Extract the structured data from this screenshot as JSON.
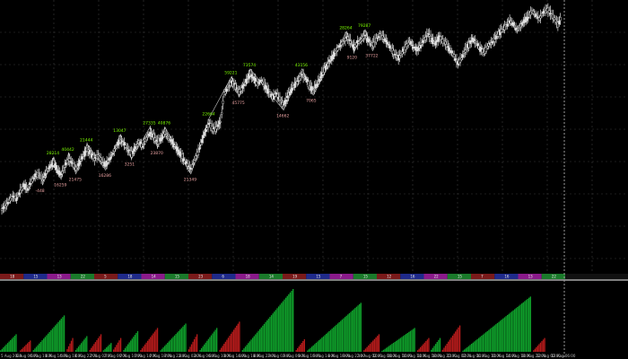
{
  "chart_data": {
    "type": "candlestick-with-histogram",
    "title": "",
    "xlabel": "",
    "ylabel": "",
    "price": [
      0.08,
      0.1,
      0.13,
      0.15,
      0.14,
      0.18,
      0.21,
      0.19,
      0.23,
      0.26,
      0.27,
      0.24,
      0.28,
      0.31,
      0.33,
      0.29,
      0.27,
      0.31,
      0.35,
      0.33,
      0.3,
      0.33,
      0.37,
      0.4,
      0.38,
      0.35,
      0.37,
      0.34,
      0.32,
      0.35,
      0.38,
      0.42,
      0.45,
      0.43,
      0.4,
      0.38,
      0.41,
      0.44,
      0.42,
      0.46,
      0.49,
      0.47,
      0.44,
      0.46,
      0.49,
      0.46,
      0.44,
      0.41,
      0.38,
      0.35,
      0.32,
      0.3,
      0.34,
      0.39,
      0.45,
      0.5,
      0.54,
      0.51,
      0.52,
      0.55,
      0.7,
      0.73,
      0.76,
      0.74,
      0.71,
      0.73,
      0.77,
      0.8,
      0.78,
      0.75,
      0.77,
      0.74,
      0.71,
      0.68,
      0.7,
      0.67,
      0.64,
      0.68,
      0.72,
      0.75,
      0.77,
      0.8,
      0.78,
      0.74,
      0.72,
      0.75,
      0.79,
      0.83,
      0.86,
      0.89,
      0.92,
      0.95,
      0.97,
      1.0,
      0.98,
      0.95,
      0.97,
      0.99,
      1.01,
      0.98,
      0.96,
      0.99,
      1.01,
      1.0,
      0.97,
      0.94,
      0.91,
      0.89,
      0.92,
      0.95,
      0.98,
      0.95,
      0.93,
      0.96,
      0.99,
      1.02,
      0.99,
      0.97,
      1.0,
      0.98,
      0.96,
      0.93,
      0.9,
      0.86,
      0.89,
      0.93,
      0.96,
      0.99,
      0.97,
      0.94,
      0.92,
      0.95,
      0.97,
      0.99,
      1.02,
      1.04,
      1.06,
      1.09,
      1.07,
      1.04,
      1.06,
      1.09,
      1.11,
      1.14,
      1.12,
      1.1,
      1.13,
      1.15,
      1.13,
      1.1,
      1.07,
      1.11
    ],
    "swing_high_labels": [
      "28214",
      "40442",
      "21444",
      "13047",
      "27335",
      "40876",
      "22664",
      "59221",
      "73574",
      "43156",
      "28264",
      "79287"
    ],
    "swing_low_labels": [
      "-448",
      "16259",
      "21475",
      "16286",
      "3251",
      "23870",
      "21349",
      "45775",
      "14662",
      "7065",
      "9120",
      "37722"
    ],
    "x_tick_labels": [
      "5 Aug 2020",
      "6 Aug 06:00",
      "6 Aug 10:00",
      "6 Aug 14:00",
      "6 Aug 18:00",
      "6 Aug 22:00",
      "7 Aug 02:00",
      "7 Aug 06:00",
      "7 Aug 10:00",
      "7 Aug 14:00",
      "7 Aug 18:00",
      "7 Aug 22:00",
      "8 Aug 02:00",
      "8 Aug 06:00",
      "8 Aug 10:00",
      "8 Aug 14:00",
      "8 Aug 18:00",
      "8 Aug 22:00",
      "9 Aug 02:00",
      "9 Aug 06:00",
      "9 Aug 10:00",
      "9 Aug 14:00",
      "9 Aug 18:00",
      "9 Aug 22:00",
      "10 Aug 02:00",
      "10 Aug 06:00",
      "10 Aug 10:00",
      "10 Aug 14:00",
      "10 Aug 18:00",
      "10 Aug 22:00",
      "11 Aug 02:00",
      "11 Aug 06:00",
      "11 Aug 10:00",
      "11 Aug 14:00",
      "11 Aug 18:00",
      "11 Aug 22:00",
      "12 Aug 02:00",
      "12 Aug 06:00"
    ],
    "session_band_labels": [
      "18",
      "15",
      "13",
      "22",
      "5",
      "18",
      "14",
      "15",
      "23",
      "6",
      "18",
      "14",
      "19",
      "15",
      "7",
      "15",
      "12",
      "16",
      "22",
      "15",
      "7",
      "16",
      "13",
      "22"
    ],
    "histogram": [
      {
        "color": "green",
        "start": 0.0,
        "end": 0.03,
        "peak": 0.28
      },
      {
        "color": "red",
        "start": 0.035,
        "end": 0.055,
        "peak": 0.18
      },
      {
        "color": "green",
        "start": 0.058,
        "end": 0.115,
        "peak": 0.58
      },
      {
        "color": "red",
        "start": 0.118,
        "end": 0.13,
        "peak": 0.22
      },
      {
        "color": "green",
        "start": 0.133,
        "end": 0.155,
        "peak": 0.25
      },
      {
        "color": "red",
        "start": 0.158,
        "end": 0.18,
        "peak": 0.28
      },
      {
        "color": "green",
        "start": 0.182,
        "end": 0.198,
        "peak": 0.14
      },
      {
        "color": "red",
        "start": 0.2,
        "end": 0.215,
        "peak": 0.22
      },
      {
        "color": "green",
        "start": 0.218,
        "end": 0.245,
        "peak": 0.33
      },
      {
        "color": "red",
        "start": 0.248,
        "end": 0.28,
        "peak": 0.38
      },
      {
        "color": "green",
        "start": 0.283,
        "end": 0.33,
        "peak": 0.45
      },
      {
        "color": "red",
        "start": 0.333,
        "end": 0.35,
        "peak": 0.28
      },
      {
        "color": "green",
        "start": 0.353,
        "end": 0.385,
        "peak": 0.38
      },
      {
        "color": "red",
        "start": 0.388,
        "end": 0.425,
        "peak": 0.48
      },
      {
        "color": "green",
        "start": 0.428,
        "end": 0.52,
        "peak": 1.0
      },
      {
        "color": "red",
        "start": 0.523,
        "end": 0.54,
        "peak": 0.2
      },
      {
        "color": "green",
        "start": 0.543,
        "end": 0.64,
        "peak": 0.78
      },
      {
        "color": "red",
        "start": 0.643,
        "end": 0.672,
        "peak": 0.28
      },
      {
        "color": "green",
        "start": 0.675,
        "end": 0.735,
        "peak": 0.38
      },
      {
        "color": "red",
        "start": 0.738,
        "end": 0.76,
        "peak": 0.22
      },
      {
        "color": "green",
        "start": 0.762,
        "end": 0.78,
        "peak": 0.22
      },
      {
        "color": "red",
        "start": 0.782,
        "end": 0.815,
        "peak": 0.42
      },
      {
        "color": "green",
        "start": 0.818,
        "end": 0.94,
        "peak": 0.88
      },
      {
        "color": "red",
        "start": 0.943,
        "end": 0.965,
        "peak": 0.22
      }
    ]
  },
  "colors": {
    "background": "#000000",
    "grid": "#3a3a3a",
    "candle": "#e0e0e0",
    "zigzag": "#c8c8c8",
    "high_label": "#7cfc00",
    "low_label": "#e8a0a0",
    "hist_green": "#0f9d2a",
    "hist_red": "#b51b1b",
    "band": [
      "#7a1a1a",
      "#1f2a8a",
      "#8a1a8a",
      "#1a7a2a"
    ]
  }
}
